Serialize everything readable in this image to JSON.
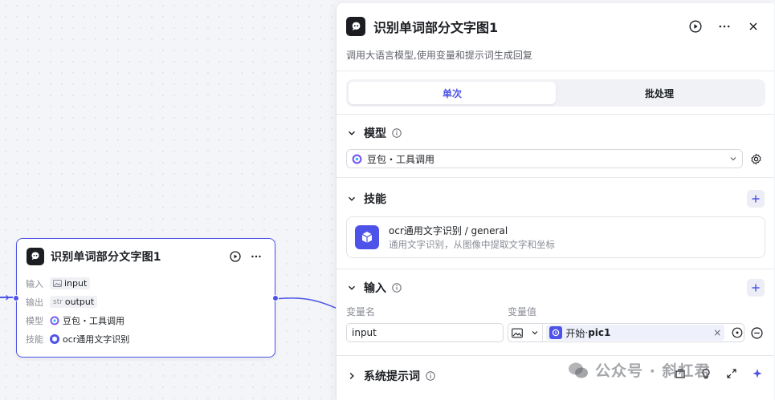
{
  "node": {
    "title": "识别单词部分文字图1",
    "rows": [
      {
        "key": "输入",
        "value": "input"
      },
      {
        "key": "输出",
        "prefix": "str",
        "value": "output"
      },
      {
        "key": "模型",
        "value": "豆包・工具调用"
      },
      {
        "key": "技能",
        "value": "ocr通用文字识别"
      }
    ]
  },
  "panel": {
    "title": "识别单词部分文字图1",
    "description": "调用大语言模型,使用变量和提示词生成回复",
    "tabs": [
      "单次",
      "批处理"
    ],
    "model_section": {
      "title": "模型",
      "selected": "豆包・工具调用"
    },
    "skills_section": {
      "title": "技能",
      "skill_name": "ocr通用文字识别 / general",
      "skill_desc": "通用文字识别，从图像中提取文字和坐标"
    },
    "input_section": {
      "title": "输入",
      "col_name": "变量名",
      "col_value": "变量值",
      "var_name": "input",
      "ref_source": "开始",
      "ref_sep": " · ",
      "ref_var": "pic1",
      "ref_remove": "×"
    },
    "prompt_section": {
      "title": "系统提示词"
    }
  },
  "watermark": {
    "text": "公众号 · 斜杠君"
  },
  "colors": {
    "accent": "#4d53e8",
    "border": "#e3e4e8",
    "muted": "#8a8d96"
  }
}
